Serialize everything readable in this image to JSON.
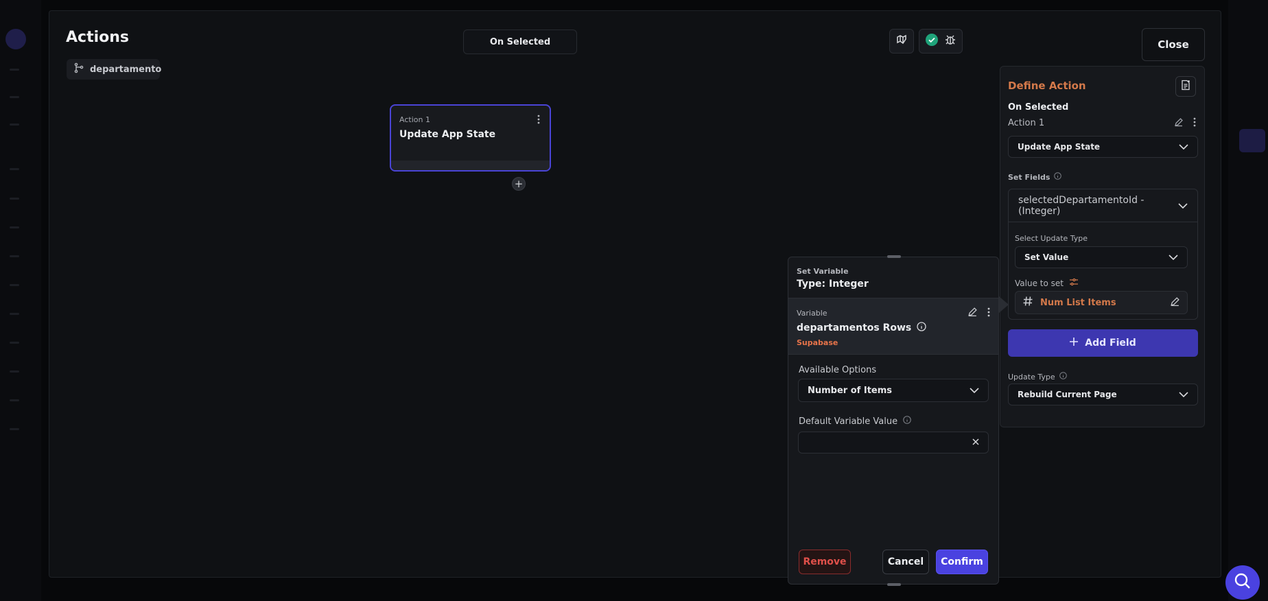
{
  "modal": {
    "title": "Actions",
    "widget_chip": "departamento",
    "trigger": "On Selected",
    "close_label": "Close"
  },
  "canvas": {
    "node": {
      "label": "Action 1",
      "name": "Update App State"
    }
  },
  "define_action": {
    "title": "Define Action",
    "trigger": "On Selected",
    "action_label": "Action 1",
    "action_type": "Update App State",
    "set_fields_label": "Set Fields",
    "field_name": "selectedDepartamentoId - (Integer)",
    "select_update_type_label": "Select Update Type",
    "update_type_value": "Set Value",
    "value_to_set_label": "Value to set",
    "value_to_set": "Num List Items",
    "add_field_label": "Add Field",
    "update_type_label": "Update Type",
    "rebuild_value": "Rebuild Current Page"
  },
  "set_variable": {
    "header_label": "Set Variable",
    "type_label": "Type: Integer",
    "variable_label": "Variable",
    "variable_name": "departamentos Rows",
    "variable_source": "Supabase",
    "available_options_label": "Available Options",
    "available_options_value": "Number of Items",
    "default_value_label": "Default Variable Value",
    "default_value": "",
    "remove_label": "Remove",
    "cancel_label": "Cancel",
    "confirm_label": "Confirm"
  },
  "colors": {
    "accent": "#4a42e0",
    "orange": "#d4794a",
    "danger": "#e0504a",
    "success": "#1fa37a"
  }
}
